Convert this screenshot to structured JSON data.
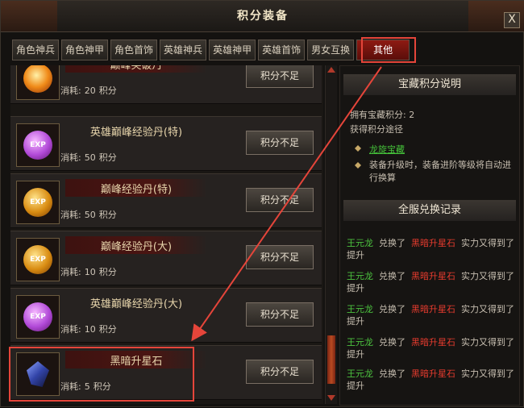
{
  "window": {
    "title": "积分装备",
    "close_label": "X"
  },
  "tabs": [
    {
      "label": "角色神兵"
    },
    {
      "label": "角色神甲"
    },
    {
      "label": "角色首饰"
    },
    {
      "label": "英雄神兵"
    },
    {
      "label": "英雄神甲"
    },
    {
      "label": "英雄首饰"
    },
    {
      "label": "男女互换"
    },
    {
      "label": "其他",
      "active": true
    }
  ],
  "items": [
    {
      "name": "巅峰突破丹",
      "cost_label": "消耗:",
      "cost_value": "20",
      "cost_unit": "积分",
      "button": "积分不足",
      "icon": "fire-pill-icon"
    },
    {
      "name": "英雄巅峰经验丹(特)",
      "cost_label": "消耗:",
      "cost_value": "50",
      "cost_unit": "积分",
      "button": "积分不足",
      "icon": "exp-orb-purple-icon",
      "orb_text": "EXP"
    },
    {
      "name": "巅峰经验丹(特)",
      "cost_label": "消耗:",
      "cost_value": "50",
      "cost_unit": "积分",
      "button": "积分不足",
      "icon": "exp-orb-gold-icon",
      "orb_text": "EXP"
    },
    {
      "name": "巅峰经验丹(大)",
      "cost_label": "消耗:",
      "cost_value": "10",
      "cost_unit": "积分",
      "button": "积分不足",
      "icon": "exp-orb-gold-icon",
      "orb_text": "EXP"
    },
    {
      "name": "英雄巅峰经验丹(大)",
      "cost_label": "消耗:",
      "cost_value": "10",
      "cost_unit": "积分",
      "button": "积分不足",
      "icon": "exp-orb-purple-icon",
      "orb_text": "EXP"
    },
    {
      "name": "黑暗升星石",
      "cost_label": "消耗:",
      "cost_value": "5",
      "cost_unit": "积分",
      "button": "积分不足",
      "icon": "dark-star-stone-icon"
    }
  ],
  "info": {
    "heading": "宝藏积分说明",
    "points_label": "拥有宝藏积分:",
    "points_value": "2",
    "ways_label": "获得积分途径",
    "link": "龙旋宝藏",
    "note": "装备升级时，装备进阶等级将自动进行换算"
  },
  "records": {
    "heading": "全服兑换记录",
    "entries": [
      {
        "player": "王元龙",
        "verb": "兑换了",
        "item": "黑暗升星石",
        "tail": "实力又得到了提升"
      },
      {
        "player": "王元龙",
        "verb": "兑换了",
        "item": "黑暗升星石",
        "tail": "实力又得到了提升"
      },
      {
        "player": "王元龙",
        "verb": "兑换了",
        "item": "黑暗升星石",
        "tail": "实力又得到了提升"
      },
      {
        "player": "王元龙",
        "verb": "兑换了",
        "item": "黑暗升星石",
        "tail": "实力又得到了提升"
      },
      {
        "player": "王元龙",
        "verb": "兑换了",
        "item": "黑暗升星石",
        "tail": "实力又得到了提升"
      }
    ]
  },
  "colors": {
    "highlight_box": "#e5453a",
    "player_name": "#4cc23f",
    "item_name": "#e63b2e",
    "active_tab": "#8e1a12"
  }
}
